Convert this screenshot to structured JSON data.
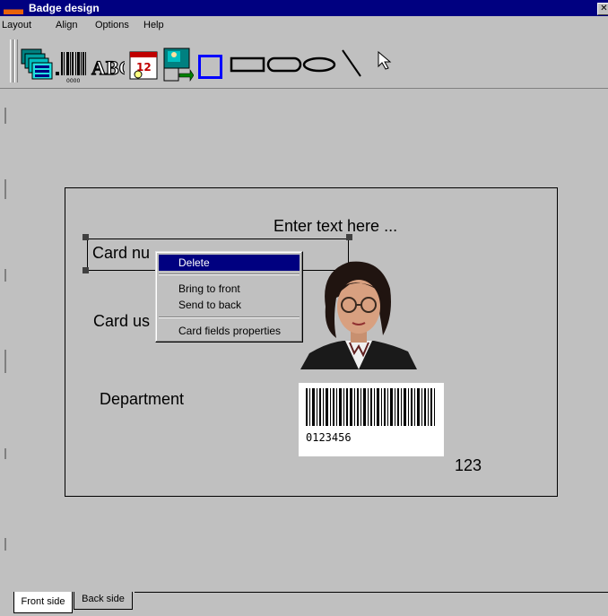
{
  "window": {
    "title": "Badge design",
    "close_glyph": "✕"
  },
  "menu": [
    "Layout",
    "Align",
    "Options",
    "Help"
  ],
  "toolbar": {
    "tools": [
      "card-stack-icon",
      "barcode-icon",
      "text-abc-icon",
      "date-calendar-icon",
      "photo-import-icon",
      "frame-icon",
      "rectangle-icon",
      "rounded-rectangle-icon",
      "ellipse-icon",
      "line-icon",
      "pointer-icon"
    ],
    "abc_label": "ABC",
    "calendar_number": "12"
  },
  "card": {
    "text_prompt": "Enter text here ...",
    "field_card_number": "Card nu",
    "field_card_user": "Card us",
    "field_department": "Department",
    "barcode_value": "0123456",
    "number_label": "123"
  },
  "context_menu": {
    "items": [
      "Delete",
      "Bring to front",
      "Send to back",
      "Card fields properties"
    ],
    "highlighted": "Delete"
  },
  "tabs": {
    "front": "Front side",
    "back": "Back side",
    "active": "Front side"
  },
  "colors": {
    "titlebar": "#000080",
    "background": "#c0c0c0",
    "highlight": "#000080",
    "frame_tool": "#0000ff"
  }
}
